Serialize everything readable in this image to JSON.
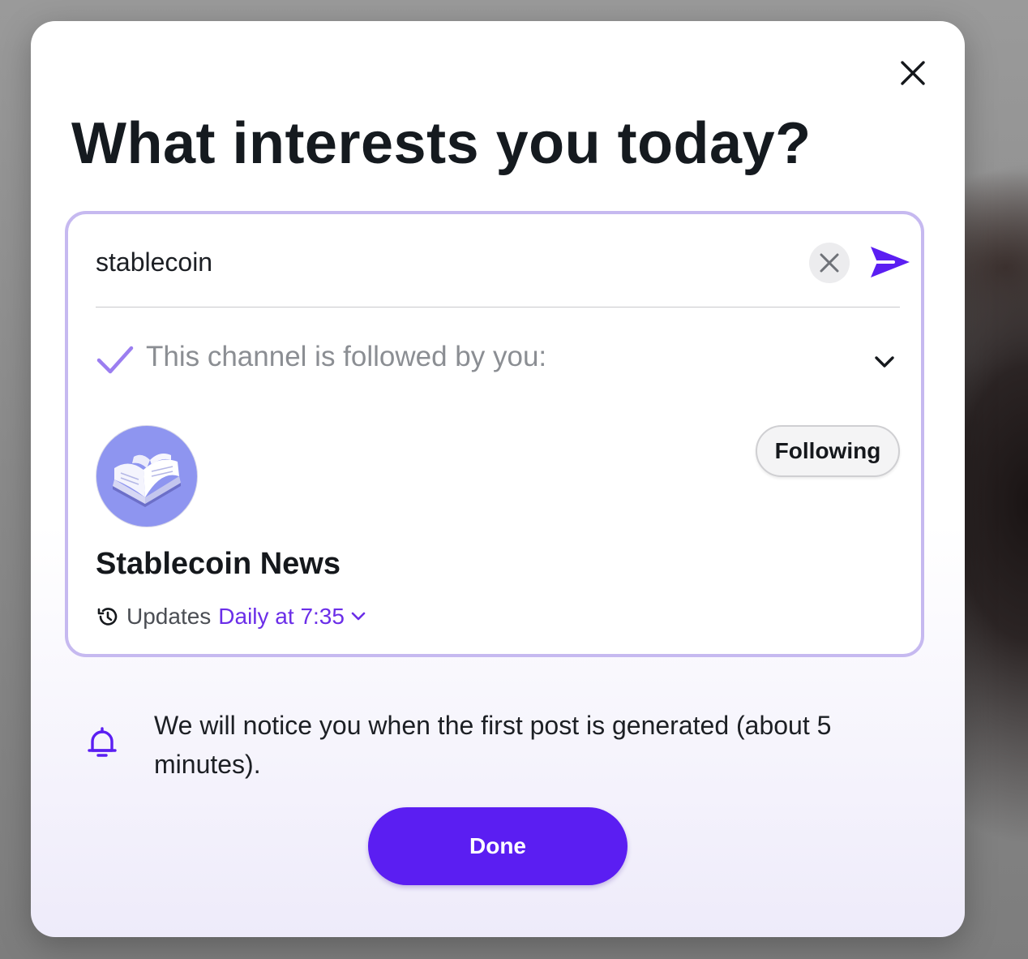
{
  "dialog": {
    "title": "What interests you today?",
    "close_icon": "close-icon"
  },
  "search": {
    "value": "stablecoin",
    "clear_icon": "clear-icon",
    "send_icon": "send-icon"
  },
  "followed_section": {
    "text": "This channel is followed by you:",
    "check_icon": "check-icon",
    "toggle_icon": "chevron-down-icon"
  },
  "channel": {
    "name": "Stablecoin News",
    "avatar_icon": "open-book-icon",
    "follow_button_label": "Following",
    "updates_label": "Updates",
    "schedule": "Daily at 7:35",
    "history_icon": "history-icon"
  },
  "notice": {
    "icon": "bell-icon",
    "text": "We will notice you when the first post is generated (about 5 minutes)."
  },
  "actions": {
    "done_label": "Done"
  },
  "colors": {
    "accent": "#5b1ef2",
    "link": "#6b2ee8",
    "card_border": "#c6b9f0",
    "check": "#9b7ef0"
  }
}
